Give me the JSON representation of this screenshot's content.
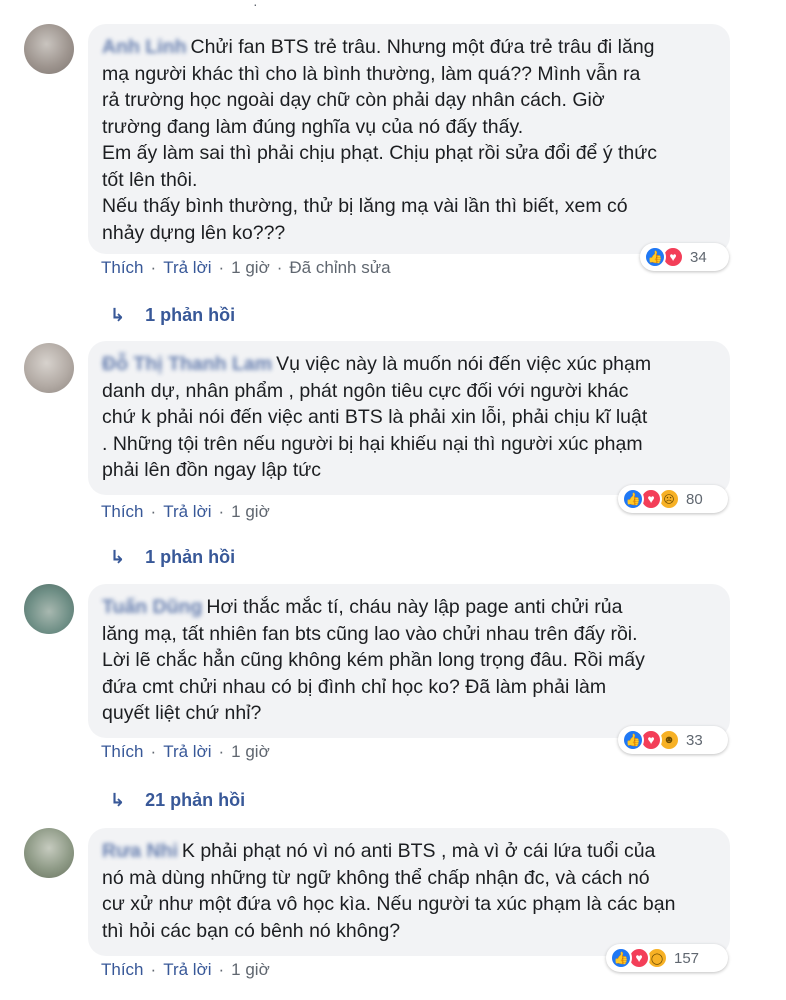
{
  "comments": [
    {
      "author": "Anh Linh",
      "lines": [
        "Chửi fan BTS trẻ trâu. Nhưng một đứa trẻ trâu đi lăng",
        "mạ người khác thì cho là bình thường, làm quá?? Mình vẫn ra",
        "rả trường học ngoài dạy chữ còn phải dạy nhân cách. Giờ",
        "trường đang làm đúng nghĩa vụ của nó đấy thấy.",
        "Em ấy làm sai thì phải chịu phạt. Chịu phạt rồi sửa đổi để ý thức",
        "tốt lên thôi.",
        "Nếu thấy bình thường, thử bị lăng mạ vài lần thì biết, xem có",
        "nhảy dựng lên ko???"
      ],
      "reactions": [
        "like-icon",
        "love-icon"
      ],
      "reaction_count": "34",
      "like_label": "Thích",
      "reply_label": "Trả lời",
      "time": "1 giờ",
      "edited": "Đã chỉnh sửa",
      "replies": "1 phản hồi"
    },
    {
      "author": "Đỗ Thị Thanh Lam",
      "lines": [
        "Vụ việc này là muốn nói đến việc xúc phạm",
        "danh dự, nhân phẩm , phát ngôn tiêu cực đối với người khác",
        "chứ k phải nói đến việc anti BTS là phải xin lỗi, phải chịu kĩ luật",
        ". Những tội trên nếu người bị hại khiếu nại thì người xúc phạm",
        "phải lên đồn ngay lập tức"
      ],
      "reactions": [
        "like-icon",
        "love-icon",
        "sad-icon"
      ],
      "reaction_count": "80",
      "like_label": "Thích",
      "reply_label": "Trả lời",
      "time": "1 giờ",
      "replies": "1 phản hồi"
    },
    {
      "author": "Tuấn Dũng",
      "lines": [
        "Hơi thắc mắc tí, cháu này lập page anti chửi rủa",
        "lăng mạ, tất nhiên fan bts cũng lao vào chửi nhau trên đấy rồi.",
        "Lời lẽ chắc hẳn cũng không kém phần long trọng đâu. Rồi mấy",
        "đứa cmt chửi nhau có bị đình chỉ học ko? Đã làm phải làm",
        "quyết liệt chứ nhỉ?"
      ],
      "reactions": [
        "like-icon",
        "love-icon",
        "haha-icon"
      ],
      "reaction_count": "33",
      "like_label": "Thích",
      "reply_label": "Trả lời",
      "time": "1 giờ",
      "replies": "21 phản hồi"
    },
    {
      "author": "Rưa Nhi",
      "lines": [
        "K phải phạt nó vì nó anti BTS , mà vì ở cái lứa tuổi của",
        "nó mà dùng những từ ngữ không thể chấp nhận đc, và cách nó",
        "cư xử như một đứa vô học kìa. Nếu người ta xúc phạm là các bạn",
        "thì hỏi các bạn có bênh nó không?"
      ],
      "reactions": [
        "like-icon",
        "love-icon",
        "wow-icon"
      ],
      "reaction_count": "157",
      "like_label": "Thích",
      "reply_label": "Trả lời",
      "time": "1 giờ"
    }
  ]
}
